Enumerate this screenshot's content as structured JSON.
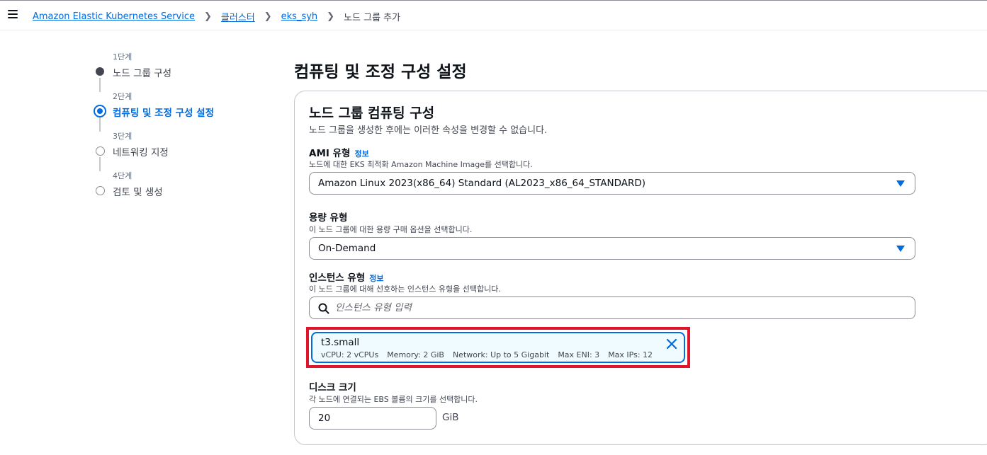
{
  "breadcrumb": {
    "items": [
      "Amazon Elastic Kubernetes Service",
      "클러스터",
      "eks_syh"
    ],
    "current": "노드 그룹 추가"
  },
  "wizard": {
    "steps": [
      {
        "number": "1단계",
        "label": "노드 그룹 구성",
        "state": "complete"
      },
      {
        "number": "2단계",
        "label": "컴퓨팅 및 조정 구성 설정",
        "state": "active"
      },
      {
        "number": "3단계",
        "label": "네트워킹 지정",
        "state": "pending"
      },
      {
        "number": "4단계",
        "label": "검토 및 생성",
        "state": "pending"
      }
    ]
  },
  "page": {
    "title": "컴퓨팅 및 조정 구성 설정"
  },
  "container": {
    "title": "노드 그룹 컴퓨팅 구성",
    "description": "노드 그룹을 생성한 후에는 이러한 속성을 변경할 수 없습니다."
  },
  "ami": {
    "label": "AMI 유형",
    "info": "정보",
    "description": "노드에 대한 EKS 최적화 Amazon Machine Image를 선택합니다.",
    "value": "Amazon Linux 2023(x86_64) Standard (AL2023_x86_64_STANDARD)"
  },
  "capacity": {
    "label": "용량 유형",
    "description": "이 노드 그룹에 대한 용량 구매 옵션을 선택합니다.",
    "value": "On-Demand"
  },
  "instance": {
    "label": "인스턴스 유형",
    "info": "정보",
    "description": "이 노드 그룹에 대해 선호하는 인스턴스 유형을 선택합니다.",
    "placeholder": "인스턴스 유형 입력",
    "selected": {
      "name": "t3.small",
      "vcpu": "vCPU: 2 vCPUs",
      "memory": "Memory: 2 GiB",
      "network": "Network: Up to 5 Gigabit",
      "max_eni": "Max ENI: 3",
      "max_ips": "Max IPs: 12"
    }
  },
  "disk": {
    "label": "디스크 크기",
    "description": "각 노드에 연결되는 EBS 볼륨의 크기를 선택합니다.",
    "value": "20",
    "unit": "GiB"
  },
  "colors": {
    "accent": "#006ce0",
    "highlight": "#e0152b",
    "token_bg": "#f0fbff"
  }
}
